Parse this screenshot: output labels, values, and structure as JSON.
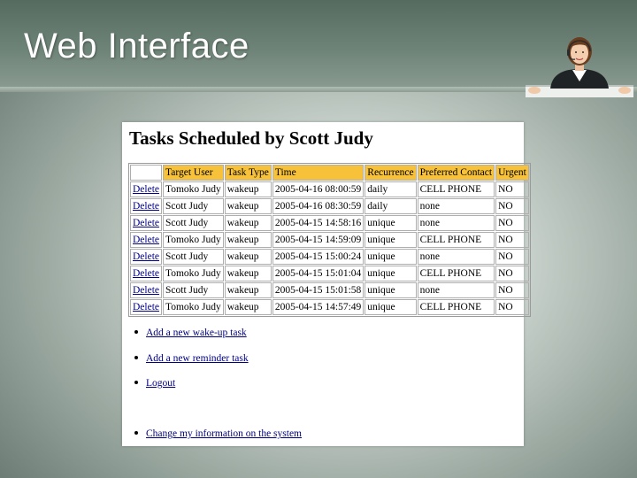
{
  "slide": {
    "title": "Web Interface"
  },
  "page": {
    "heading": "Tasks Scheduled by Scott Judy",
    "table": {
      "headers": [
        "",
        "Target User",
        "Task Type",
        "Time",
        "Recurrence",
        "Preferred Contact",
        "Urgent"
      ],
      "rows": [
        [
          "Delete",
          "Tomoko Judy",
          "wakeup",
          "2005-04-16 08:00:59",
          "daily",
          "CELL PHONE",
          "NO"
        ],
        [
          "Delete",
          "Scott Judy",
          "wakeup",
          "2005-04-16 08:30:59",
          "daily",
          "none",
          "NO"
        ],
        [
          "Delete",
          "Scott Judy",
          "wakeup",
          "2005-04-15 14:58:16",
          "unique",
          "none",
          "NO"
        ],
        [
          "Delete",
          "Tomoko Judy",
          "wakeup",
          "2005-04-15 14:59:09",
          "unique",
          "CELL PHONE",
          "NO"
        ],
        [
          "Delete",
          "Scott Judy",
          "wakeup",
          "2005-04-15 15:00:24",
          "unique",
          "none",
          "NO"
        ],
        [
          "Delete",
          "Tomoko Judy",
          "wakeup",
          "2005-04-15 15:01:04",
          "unique",
          "CELL PHONE",
          "NO"
        ],
        [
          "Delete",
          "Scott Judy",
          "wakeup",
          "2005-04-15 15:01:58",
          "unique",
          "none",
          "NO"
        ],
        [
          "Delete",
          "Tomoko Judy",
          "wakeup",
          "2005-04-15 14:57:49",
          "unique",
          "CELL PHONE",
          "NO"
        ]
      ]
    },
    "links": [
      "Add a new wake-up task",
      "Add a new reminder task",
      "Logout",
      "Change my information on the system"
    ]
  },
  "colors": {
    "header_bg": "#f7c13a",
    "link": "#000080",
    "title_text": "#ffffff"
  },
  "icons": {
    "agent": "headset-agent-icon"
  }
}
